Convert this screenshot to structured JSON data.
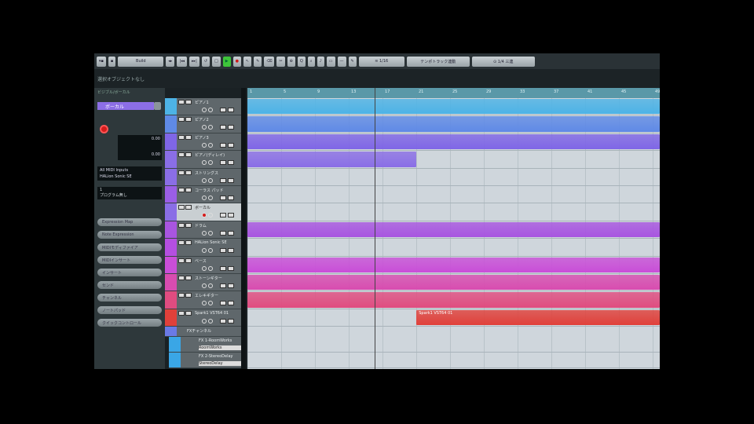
{
  "toolbar": {
    "buttons": [
      "▾▪",
      "▪",
      "Build",
      "◂▸",
      "|◂◂",
      "▸▸|",
      "↺",
      "□",
      "▶",
      "●",
      "↖",
      "✎",
      "⌫",
      "✂",
      "⊕",
      "Q",
      "⌕",
      "♪",
      "▭",
      "—",
      "✎",
      "≋ 1/16",
      "テンポトラック連動",
      "⊙ 1/4 三連"
    ]
  },
  "info_line": "選択オブジェクトなし",
  "inspector": {
    "title": "ビジブル/ボーカル",
    "track_name": "ボーカル",
    "meter_top": "0.00",
    "meter_bottom": "0.00",
    "input": "All MIDI Inputs",
    "output": "HALion Sonic SE",
    "channel": "1",
    "program": "プログラム無し",
    "sections": [
      "Expression Map",
      "Note Expression",
      "MIDIモディファイア",
      "MIDIインサート",
      "インサート",
      "センド",
      "チャンネル",
      "ノートパッド",
      "クイックコントロール"
    ]
  },
  "tracks": [
    {
      "name": "ピアノ1",
      "color": "#4db3e6",
      "event": [
        0,
        1
      ]
    },
    {
      "name": "ピアノ2",
      "color": "#5f8ae6",
      "event": [
        0,
        1
      ]
    },
    {
      "name": "ピアノ3",
      "color": "#7f66e6",
      "event": [
        0,
        1
      ]
    },
    {
      "name": "ピアノ(ディレイ)",
      "color": "#8a6ee6",
      "event": [
        0,
        0.41
      ]
    },
    {
      "name": "ストリングス",
      "color": "#8a6ee6"
    },
    {
      "name": "コーラス パッド",
      "color": "#9a5ee6"
    },
    {
      "name": "ボーカル",
      "color": "#8a6ee6",
      "selected": true
    },
    {
      "name": "ドラム",
      "color": "#a855e0",
      "event": [
        0,
        1
      ]
    },
    {
      "name": "HALion Sonic SE",
      "color": "#b44fe0"
    },
    {
      "name": "ベース",
      "color": "#c94ed8",
      "event": [
        0,
        1
      ]
    },
    {
      "name": "ストーンギター",
      "color": "#d84cb0",
      "event": [
        0,
        1
      ]
    },
    {
      "name": "エレキギター",
      "color": "#e04c80",
      "event": [
        0,
        1
      ]
    },
    {
      "name": "Spark1 VST64 01",
      "color": "#e0403a",
      "event": [
        0.41,
        1
      ],
      "event_label": "Spark1 VST64 01"
    }
  ],
  "fx_folder": {
    "name": "FXチャンネル",
    "color": "#6a7ae6"
  },
  "fx_tracks": [
    {
      "name": "FX 1-RoomWorks",
      "color": "#3aa6e6",
      "insert": "RoomWorks"
    },
    {
      "name": "FX 2-StereoDelay",
      "color": "#3aa6e6",
      "insert": "StereoDelay"
    }
  ],
  "ruler": [
    "1",
    "5",
    "9",
    "13",
    "17",
    "21",
    "25",
    "29",
    "33",
    "37",
    "41",
    "45",
    "49"
  ],
  "playhead_bar": 17
}
